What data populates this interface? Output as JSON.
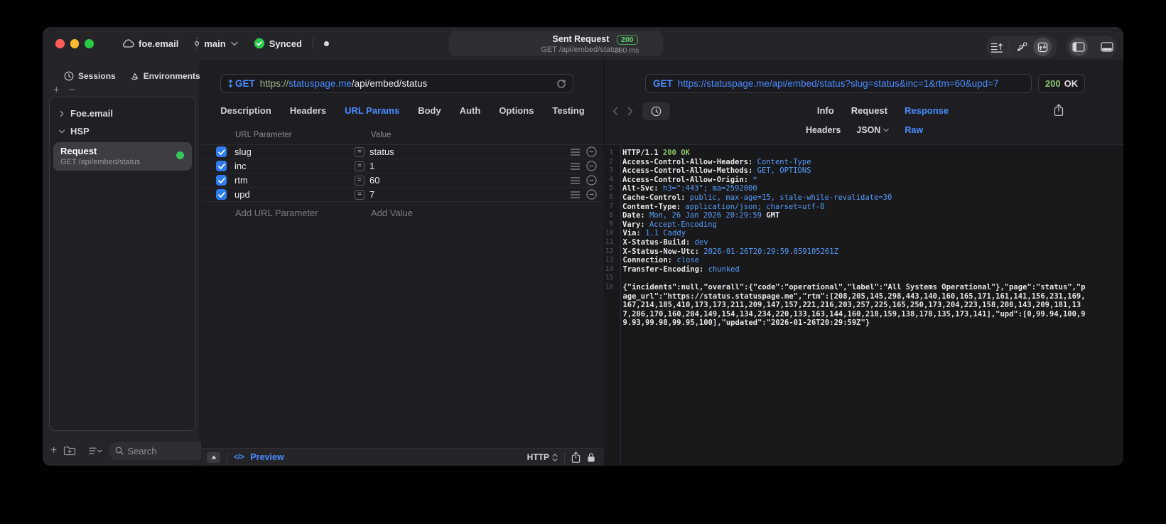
{
  "icons": {
    "plus": "+",
    "minus": "−",
    "equals": "=",
    "code": "</>"
  },
  "colors": {
    "accent_blue": "#4a8cff",
    "success_green": "#32d74b",
    "code_value_blue": "#569cf8",
    "code_green": "#87c368",
    "checkbox_blue": "#2f7cf7",
    "traffic_red": "#ff5f57",
    "traffic_yellow": "#febc2e",
    "traffic_green": "#28c840"
  },
  "titlebar": {
    "project": "foe.email",
    "branch": "main",
    "sync_label": "Synced",
    "request_pill": {
      "title": "Sent Request",
      "subtitle": "GET /api/embed/status",
      "status_code": "200",
      "duration": "280 ms"
    }
  },
  "sidebar": {
    "tabs": [
      {
        "label": "Sessions"
      },
      {
        "label": "Environments"
      }
    ],
    "tree": [
      {
        "label": "Foe.email"
      },
      {
        "label": "HSP"
      }
    ],
    "request_item": {
      "name": "Request",
      "subtitle": "GET /api/embed/status"
    },
    "search_placeholder": "Search"
  },
  "request_pane": {
    "method": "GET",
    "url_scheme": "https://",
    "url_host": "statuspage.me",
    "url_path": "/api/embed/status",
    "tabs": [
      "Description",
      "Headers",
      "URL Params",
      "Body",
      "Auth",
      "Options",
      "Testing"
    ],
    "active_tab": "URL Params",
    "params_table": {
      "columns": [
        "URL Parameter",
        "Value"
      ],
      "rows": [
        {
          "name": "slug",
          "value": "status",
          "enabled": true
        },
        {
          "name": "inc",
          "value": "1",
          "enabled": true
        },
        {
          "name": "rtm",
          "value": "60",
          "enabled": true
        },
        {
          "name": "upd",
          "value": "7",
          "enabled": true
        }
      ],
      "add_param_label": "Add URL Parameter",
      "add_value_label": "Add Value"
    },
    "footer": {
      "preview_label": "Preview",
      "protocol_label": "HTTP"
    }
  },
  "response_pane": {
    "method": "GET",
    "url": "https://statuspage.me/api/embed/status?slug=status&inc=1&rtm=60&upd=7",
    "status_code": "200",
    "status_text": "OK",
    "tabs": [
      "Info",
      "Request",
      "Response"
    ],
    "active_tab": "Response",
    "subtabs": [
      "Headers",
      "JSON",
      "Raw"
    ],
    "active_subtab": "Raw",
    "lines": [
      {
        "n": "1",
        "a": "HTTP/1.1 ",
        "g": "200 OK"
      },
      {
        "n": "2",
        "a": "Access-Control-Allow-Headers: ",
        "b": "Content-Type"
      },
      {
        "n": "3",
        "a": "Access-Control-Allow-Methods: ",
        "b": "GET, OPTIONS"
      },
      {
        "n": "4",
        "a": "Access-Control-Allow-Origin: ",
        "b": "*"
      },
      {
        "n": "5",
        "a": "Alt-Svc: ",
        "b": "h3=\":443\"; ma=2592000"
      },
      {
        "n": "6",
        "a": "Cache-Control: ",
        "b": "public, max-age=15, stale-while-revalidate=30"
      },
      {
        "n": "7",
        "a": "Content-Type: ",
        "b": "application/json; charset=utf-8"
      },
      {
        "n": "8",
        "a": "Date: ",
        "b": "Mon, 26 Jan 2026 20:29:59 ",
        "c": "GMT"
      },
      {
        "n": "9",
        "a": "Vary: ",
        "b": "Accept-Encoding"
      },
      {
        "n": "10",
        "a": "Via: ",
        "b": "1.1 Caddy"
      },
      {
        "n": "11",
        "a": "X-Status-Build: ",
        "b": "dev"
      },
      {
        "n": "12",
        "a": "X-Status-Now-Utc: ",
        "b": "2026-01-26T20:29:59.859105261Z"
      },
      {
        "n": "13",
        "a": "Connection: ",
        "b": "close"
      },
      {
        "n": "14",
        "a": "Transfer-Encoding: ",
        "b": "chunked"
      },
      {
        "n": "15",
        "a": ""
      },
      {
        "n": "16",
        "a": "{\"incidents\":null,\"overall\":{\"code\":\"operational\",\"label\":\"All Systems Operational\"},\"page\":\"status\",\"page_url\":\"https://status.statuspage.me\",\"rtm\":[208,205,145,298,443,140,160,165,171,161,141,156,231,169,167,214,185,410,173,173,211,209,147,157,221,216,203,257,225,165,250,173,204,223,158,208,143,209,181,137,206,170,160,204,149,154,134,234,220,133,163,144,160,218,159,138,178,135,173,141],\"upd\":[0,99.94,100,99.93,99.98,99.95,100],\"updated\":\"2026-01-26T20:29:59Z\"}"
      }
    ]
  }
}
